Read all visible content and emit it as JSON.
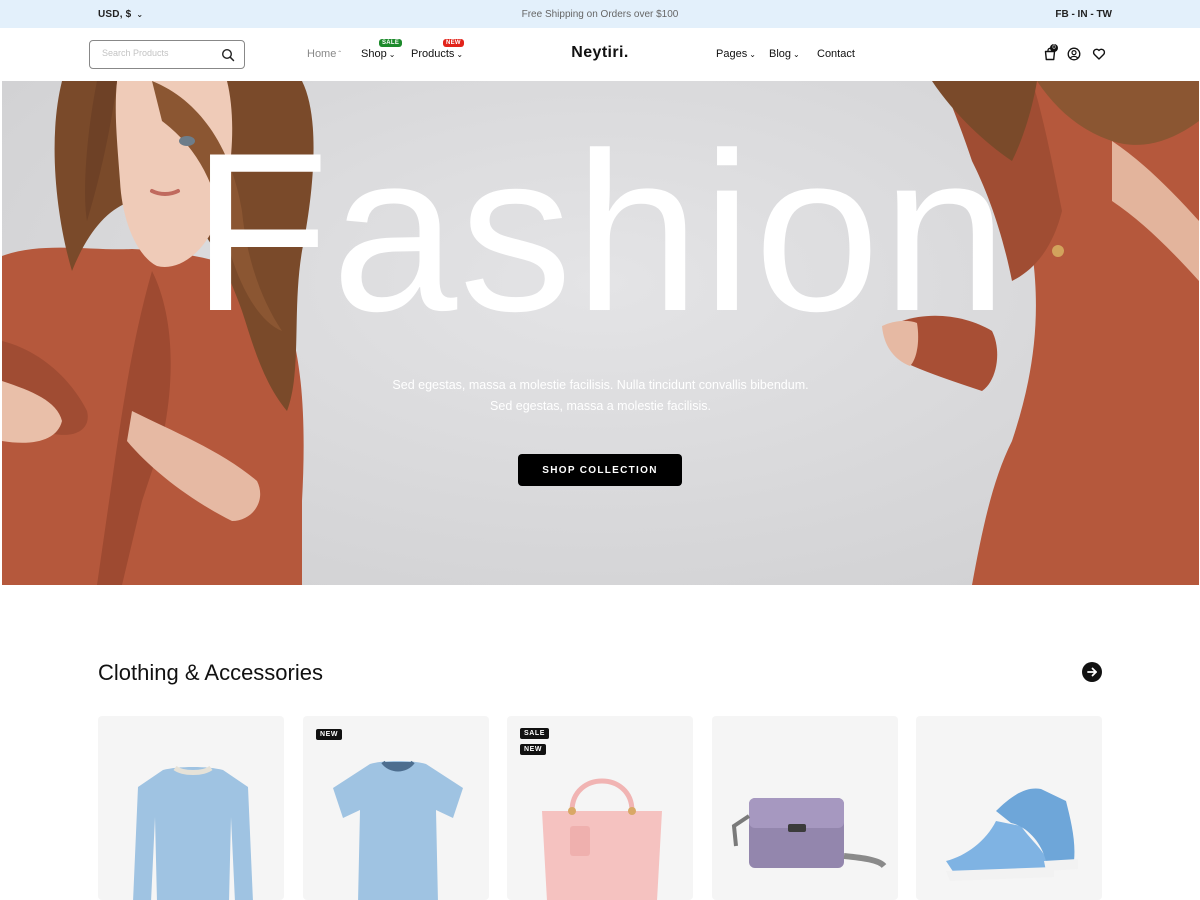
{
  "topbar": {
    "currency": "USD, $",
    "promo": "Free Shipping on Orders over $100",
    "social": "FB - IN - TW"
  },
  "header": {
    "search_placeholder": "Search Products",
    "logo": "Neytiri.",
    "nav_left": [
      {
        "label": "Home"
      },
      {
        "label": "Shop",
        "badge": "SALE"
      },
      {
        "label": "Products",
        "badge": "NEW"
      }
    ],
    "nav_right": [
      {
        "label": "Pages"
      },
      {
        "label": "Blog"
      },
      {
        "label": "Contact"
      }
    ],
    "cart_count": "0"
  },
  "hero": {
    "title": "Fashion",
    "subtitle_line1": "Sed egestas, massa a molestie facilisis. Nulla tincidunt convallis bibendum.",
    "subtitle_line2": "Sed egestas, massa a molestie facilisis.",
    "button": "SHOP COLLECTION"
  },
  "section": {
    "title": "Clothing & Accessories"
  },
  "products": [
    {
      "name": "long-sleeve-shirt",
      "tags": []
    },
    {
      "name": "t-shirt",
      "tags": [
        "NEW"
      ]
    },
    {
      "name": "handbag",
      "tags": [
        "SALE",
        "NEW"
      ]
    },
    {
      "name": "crossbody-bag",
      "tags": []
    },
    {
      "name": "sneakers",
      "tags": []
    }
  ],
  "colors": {
    "topbar_bg": "#e3f0fb",
    "sale_badge": "#1c8a2b",
    "new_badge": "#e2231a",
    "jacket": "#b5583c",
    "product_blue": "#9fc3e2"
  }
}
